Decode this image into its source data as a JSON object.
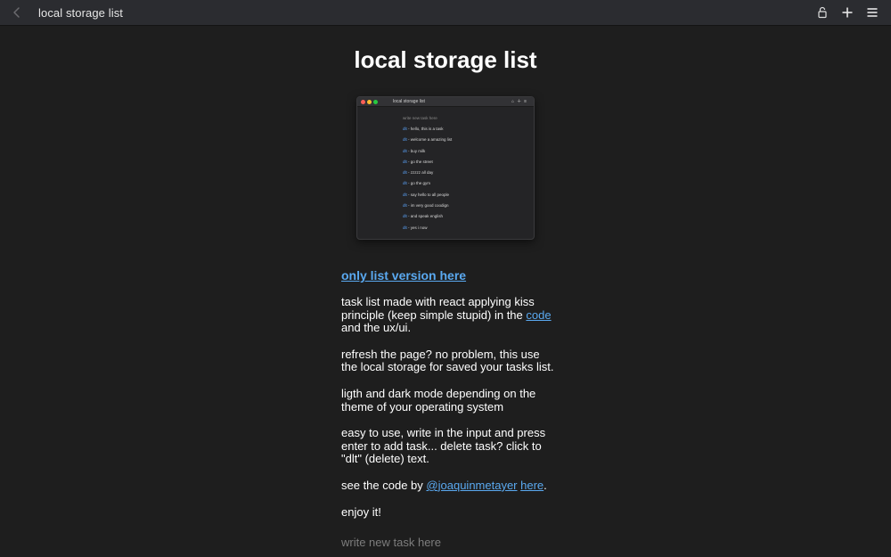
{
  "window": {
    "title": "local storage list"
  },
  "page": {
    "title": "local storage list"
  },
  "preview": {
    "title": "local storage list",
    "input_placeholder": "write new task here",
    "dlt_label": "dlt",
    "items": [
      "hello, this is a task",
      "welcome a amazing list",
      "buy milk",
      "go the street",
      "zzzzz all day",
      "go the gym",
      "say hello to all people",
      "im very good coodign",
      "and speak english",
      "yes i now"
    ]
  },
  "content": {
    "only_list_link": "only list version here",
    "p1_text": "task list made with react applying kiss principle (keep simple stupid) in the",
    "p1_link": "code",
    "p1_end": "and the ux/ui.",
    "p2": "refresh the page? no problem, this use the local storage for saved your tasks list.",
    "p3": "ligth and dark mode depending on the theme of your operating system",
    "p4": "easy to use, write in the input and press enter to add task... delete task? click to \"dlt\" (delete) text.",
    "p5_text": "see the code by",
    "p5_link1": "@joaquinmetayer",
    "p5_link2": "here",
    "p5_end": ".",
    "p6": "enjoy it!"
  },
  "input": {
    "placeholder": "write new task here"
  },
  "colors": {
    "accent": "#5aa9f0",
    "background": "#1e1e1e",
    "titlebar": "#2b2c30"
  },
  "icons": {
    "back": "chevron-left-icon",
    "lock": "lock-icon",
    "add": "plus-icon",
    "menu": "hamburger-menu-icon"
  }
}
